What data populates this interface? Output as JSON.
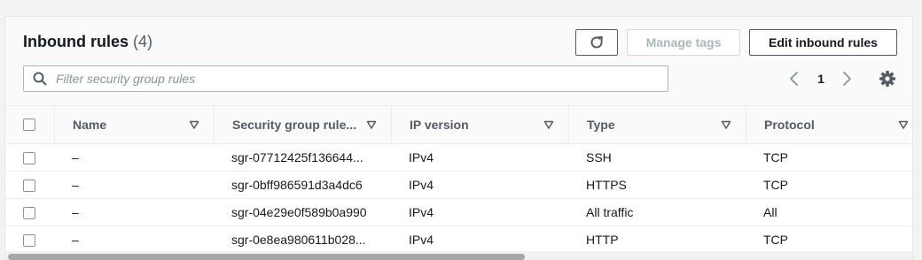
{
  "header": {
    "title": "Inbound rules",
    "count": "(4)",
    "manage_tags_label": "Manage tags",
    "edit_label": "Edit inbound rules"
  },
  "search": {
    "placeholder": "Filter security group rules"
  },
  "pagination": {
    "current_page": "1"
  },
  "table": {
    "columns": [
      "Name",
      "Security group rule...",
      "IP version",
      "Type",
      "Protocol"
    ],
    "rows": [
      [
        "–",
        "sgr-07712425f136644...",
        "IPv4",
        "SSH",
        "TCP"
      ],
      [
        "–",
        "sgr-0bff986591d3a4dc6",
        "IPv4",
        "HTTPS",
        "TCP"
      ],
      [
        "–",
        "sgr-04e29e0f589b0a990",
        "IPv4",
        "All traffic",
        "All"
      ],
      [
        "–",
        "sgr-0e8ea980611b028...",
        "IPv4",
        "HTTP",
        "TCP"
      ]
    ]
  },
  "icons": {
    "refresh": "refresh-icon",
    "search": "search-icon",
    "settings": "gear-icon",
    "sort": "caret-down-icon",
    "prev": "chevron-left-icon",
    "next": "chevron-right-icon"
  },
  "colors": {
    "text": "#16191f",
    "muted": "#545b64",
    "disabled": "#aab7b8"
  }
}
